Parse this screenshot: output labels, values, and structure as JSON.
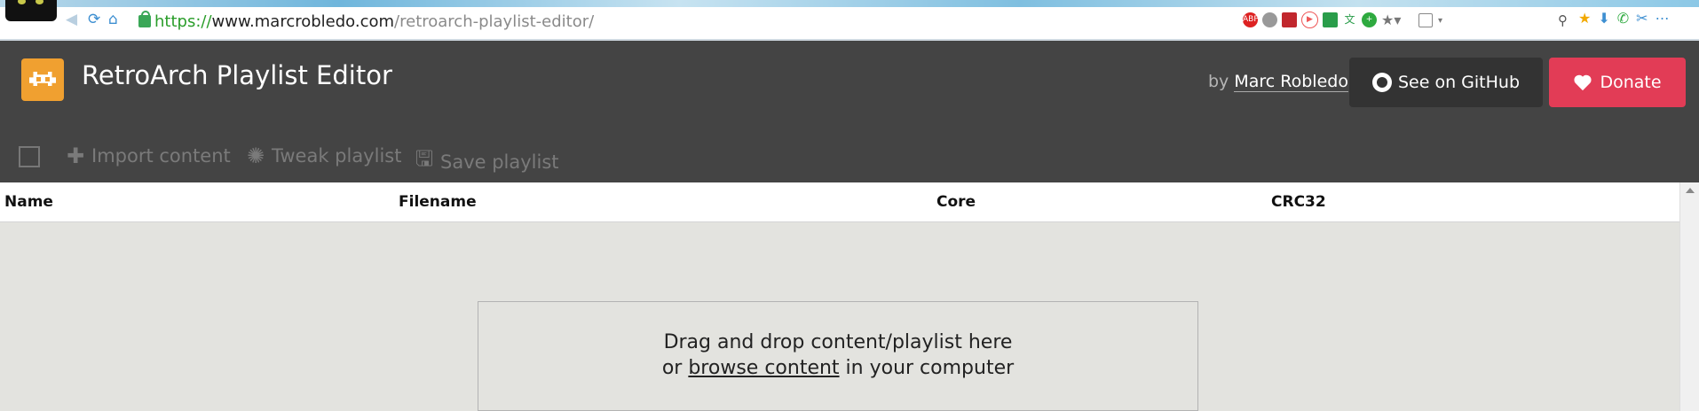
{
  "browser": {
    "url_scheme": "https://",
    "url_domain": "www.marcrobledo.com",
    "url_path": "/retroarch-playlist-editor/"
  },
  "header": {
    "app_title": "RetroArch Playlist Editor",
    "by_label": "by",
    "author": "Marc Robledo",
    "github_label": "See on GitHub",
    "donate_label": "Donate"
  },
  "toolbar": {
    "import_label": "Import content",
    "tweak_label": "Tweak playlist",
    "save_label": "Save playlist"
  },
  "table": {
    "columns": [
      "Name",
      "Filename",
      "Core",
      "CRC32"
    ]
  },
  "dropzone": {
    "line1": "Drag and drop content/playlist here",
    "line2_prefix": "or",
    "browse_link": "browse content",
    "line2_suffix": "in your computer"
  },
  "colors": {
    "header_bg": "#444444",
    "donate": "#e23c56",
    "github_btn": "#333333",
    "logo": "#f0a030",
    "content_bg": "#e3e3df"
  }
}
